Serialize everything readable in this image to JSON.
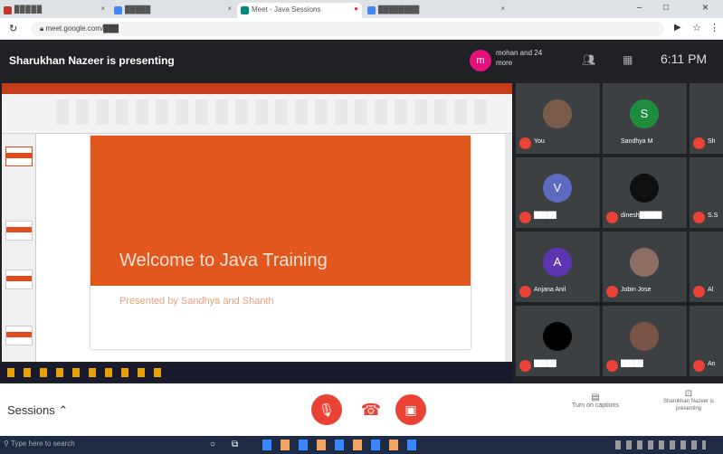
{
  "browser": {
    "tabs": [
      {
        "label": "▉▉▉▉▉",
        "active": false,
        "color": "#c0392b"
      },
      {
        "label": "█████",
        "active": false,
        "color": "#4285f4"
      },
      {
        "label": "Meet - Java Sessions",
        "active": true,
        "color": "#00897b"
      },
      {
        "label": "████████",
        "active": false,
        "color": "#4285f4"
      }
    ],
    "url": "meet.google.com/███"
  },
  "meet": {
    "presenting": "Sharukhan Nazeer is presenting",
    "presenter_avatar": "m",
    "presenter_label": "mohan and 24 more",
    "time": "6:11 PM",
    "slide": {
      "title": "Welcome to Java Training",
      "subtitle": "Presented by Sandhya and Shanth"
    },
    "participants": [
      {
        "name": "You",
        "initial": "",
        "color": "#7a5c4a"
      },
      {
        "name": "Sandhya M",
        "initial": "S",
        "color": "#1e8e3e"
      },
      {
        "name": "Sh",
        "initial": "",
        "color": "#555"
      },
      {
        "name": "█████",
        "initial": "V",
        "color": "#5c6bc0"
      },
      {
        "name": "dinesh█████",
        "initial": "",
        "color": "#111"
      },
      {
        "name": "S.S",
        "initial": "",
        "color": "#6b8e23"
      },
      {
        "name": "Anjana Anil",
        "initial": "A",
        "color": "#5e35b1"
      },
      {
        "name": "Jobin Jose",
        "initial": "",
        "color": "#8d6e63"
      },
      {
        "name": "Al",
        "initial": "",
        "color": "#666"
      },
      {
        "name": "█████",
        "initial": "",
        "color": "#000"
      },
      {
        "name": "█████",
        "initial": "",
        "color": "#795548"
      },
      {
        "name": "An",
        "initial": "",
        "color": "#666"
      }
    ],
    "sessions_label": "Sessions",
    "captions_label": "Turn on captions",
    "present_label": "Sharukhan Nazeer is presenting"
  },
  "taskbar": {
    "search": "Type here to search"
  }
}
